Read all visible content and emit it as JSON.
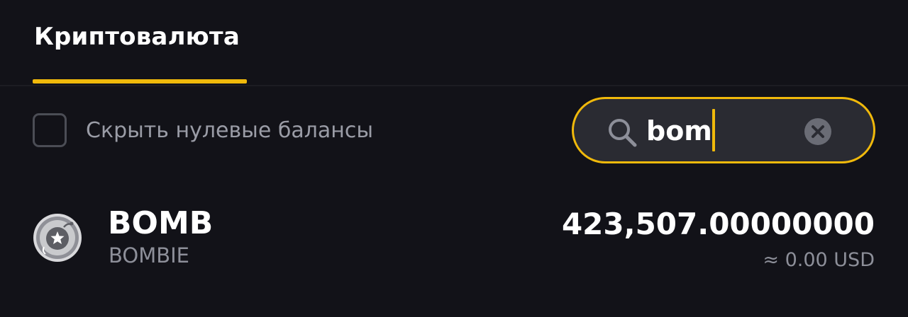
{
  "tabs": [
    {
      "label": "Криптовалюта",
      "active": true
    }
  ],
  "filter": {
    "hide_zero_label": "Скрыть нулевые балансы",
    "hide_zero_checked": false
  },
  "search": {
    "value": "bom",
    "icon": "search-icon",
    "clear_icon": "clear-icon"
  },
  "assets": [
    {
      "symbol": "BOMB",
      "name": "BOMBIE",
      "amount": "423,507.00000000",
      "usd_value": "≈ 0.00 USD",
      "icon": "bombie-coin-icon"
    }
  ],
  "colors": {
    "background": "#121218",
    "accent": "#f0b90b",
    "text_primary": "#ffffff",
    "text_secondary": "#8d8f99",
    "input_background": "#2a2b32"
  }
}
